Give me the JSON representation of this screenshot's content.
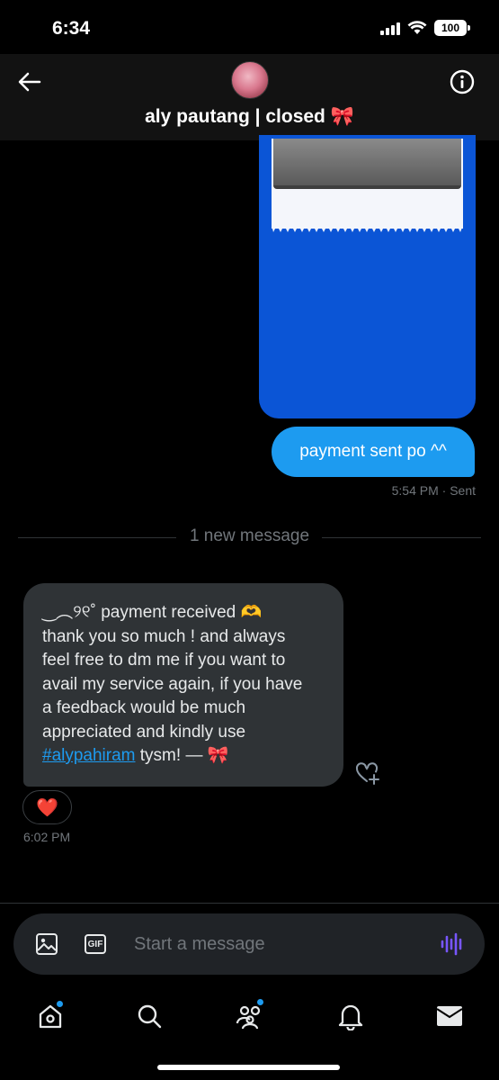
{
  "status_bar": {
    "time": "6:34",
    "battery": "100"
  },
  "header": {
    "title": "aly pautang | closed 🎀",
    "back_icon": "arrow-left-icon",
    "info_icon": "info-circle-icon"
  },
  "messages": {
    "sent_text": "payment sent po ^^",
    "sent_meta": "5:54 PM · Sent",
    "divider_text": "1 new message",
    "received_lines": [
      "‿︵୨୧˚ payment received 🫶",
      "thank you so much ! and always",
      "feel free to dm me if you want to",
      "avail my service again, if you have",
      "a feedback would be much",
      "appreciated and kindly use"
    ],
    "received_hashtag": "#alypahiram",
    "received_tail": " tysm! — 🎀",
    "reaction": "❤️",
    "received_time": "6:02 PM"
  },
  "composer": {
    "placeholder": "Start a message",
    "gif_label": "GIF",
    "accent_color": "#7856ff"
  },
  "nav": {
    "items": [
      "home-icon",
      "search-icon",
      "communities-icon",
      "notifications-icon",
      "messages-icon"
    ]
  },
  "colors": {
    "sent_bubble": "#1d9bf0",
    "received_bubble": "#2f3336",
    "link": "#1d9bf0"
  }
}
